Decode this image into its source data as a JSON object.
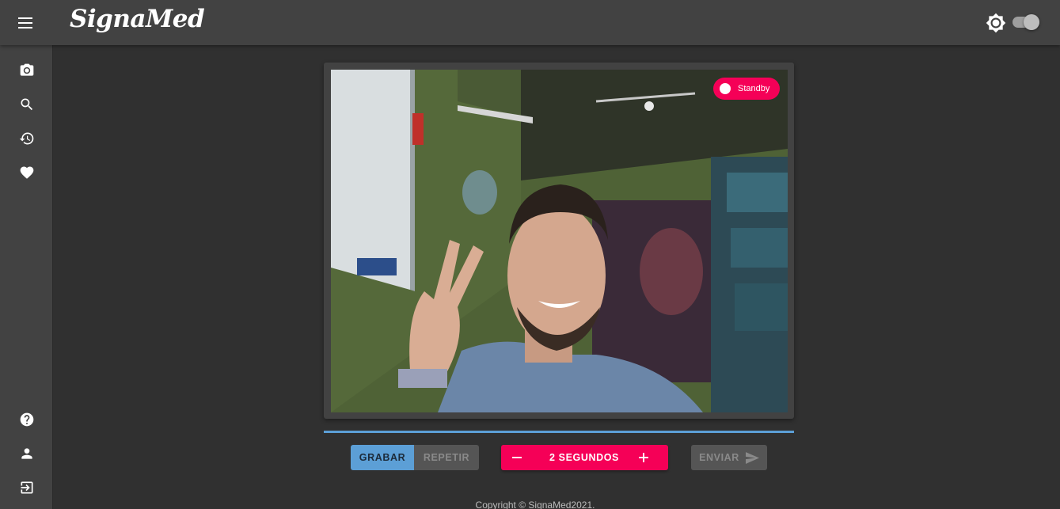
{
  "app": {
    "title": "SignaMed"
  },
  "header": {
    "menu_icon": "menu-icon",
    "theme_icon": "brightness-icon",
    "theme_toggle": {
      "state": "on"
    }
  },
  "sidebar": {
    "top_items": [
      {
        "icon": "camera-icon"
      },
      {
        "icon": "search-icon"
      },
      {
        "icon": "history-icon"
      },
      {
        "icon": "heart-icon"
      }
    ],
    "bottom_items": [
      {
        "icon": "help-icon"
      },
      {
        "icon": "account-icon"
      },
      {
        "icon": "logout-icon"
      }
    ]
  },
  "video": {
    "status_label": "Standby",
    "status_color": "#f50057"
  },
  "recording": {
    "progress": 1.0,
    "progress_color": "#5c9fd6"
  },
  "controls": {
    "record_label": "GRABAR",
    "repeat_label": "REPETIR",
    "duration_label": "2 SEGUNDOS",
    "send_label": "ENVIAR",
    "accent": "#f50057",
    "primary": "#5c9fd6"
  },
  "footer": {
    "copyright": "Copyright © SignaMed2021."
  }
}
